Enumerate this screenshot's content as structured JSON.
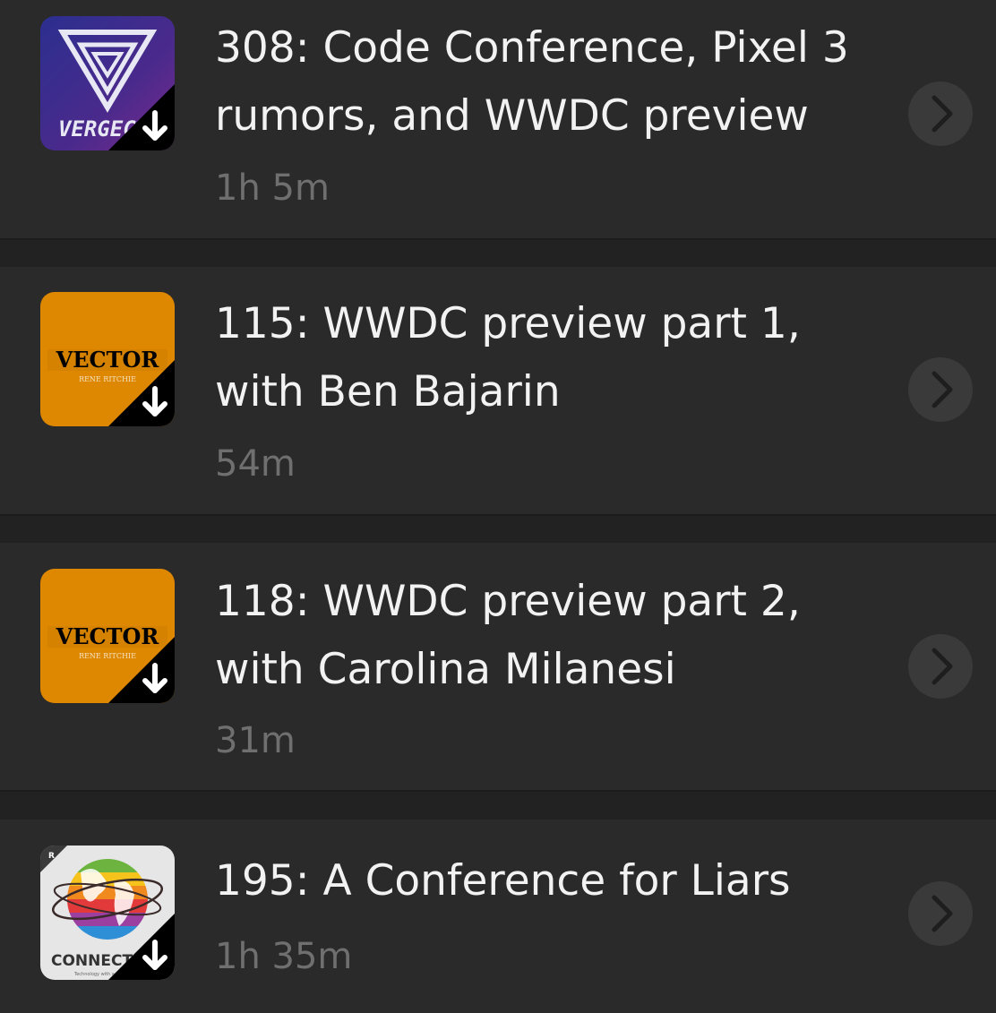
{
  "episodes": [
    {
      "title": "308: Code Conference, Pixel 3 rumors, and WWDC preview",
      "duration": "1h 5m",
      "artwork": {
        "text": "VERGECAST",
        "icon": "vergecast-artwork-icon",
        "downloaded": true
      }
    },
    {
      "title": "115: WWDC preview part 1, with Ben Bajarin",
      "duration": "54m",
      "artwork": {
        "text": "VECTOR",
        "subtext": "RENE RITCHIE",
        "icon": "vector-artwork-icon",
        "downloaded": true
      }
    },
    {
      "title": "118: WWDC preview part 2, with Carolina Milanesi",
      "duration": "31m",
      "artwork": {
        "text": "VECTOR",
        "subtext": "RENE RITCHIE",
        "icon": "vector-artwork-icon",
        "downloaded": true
      }
    },
    {
      "title": "195: A Conference for Liars",
      "duration": "1h 35m",
      "artwork": {
        "text": "CONNECTED",
        "subtext": "Technology with a Human Touch",
        "badge": "R",
        "icon": "connected-artwork-icon",
        "downloaded": true
      }
    }
  ],
  "colors": {
    "row_background": "#2a2a2a",
    "title_text": "#f2f2f2",
    "duration_text": "#6f6f6f",
    "chevron_bg": "#3a3a3a",
    "vector_orange": "#de8700"
  },
  "icons": {
    "chevron": "chevron-right-icon",
    "download": "download-arrow-icon"
  }
}
